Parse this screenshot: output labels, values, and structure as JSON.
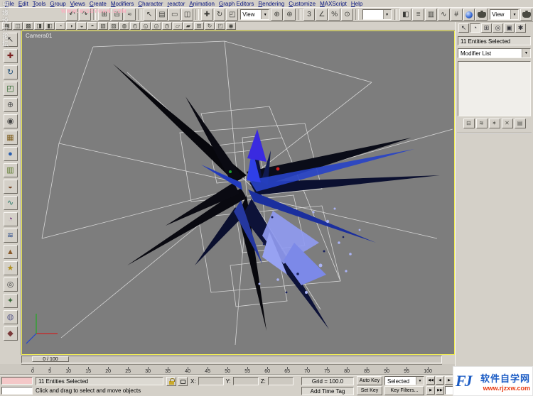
{
  "watermarks": {
    "forum_vertical": "思缘设计论坛",
    "forum_url": "WWW.MISSYUAN.COM",
    "site_logo": "FJ",
    "site_name": "软件自学网",
    "site_url": "www.rjzxw.com"
  },
  "icons": {
    "dropdown_arrow": "▼"
  },
  "menu": {
    "items": [
      "File",
      "Edit",
      "Tools",
      "Group",
      "Views",
      "Create",
      "Modifiers",
      "Character",
      "reactor",
      "Animation",
      "Graph Editors",
      "Rendering",
      "Customize",
      "MAXScript",
      "Help"
    ]
  },
  "toolbar_main": {
    "items": [
      {
        "t": "icon",
        "name": "undo",
        "g": "↶"
      },
      {
        "t": "icon",
        "name": "redo",
        "g": "↷"
      },
      {
        "t": "sep"
      },
      {
        "t": "icon",
        "name": "select-and-link",
        "g": "⊞"
      },
      {
        "t": "icon",
        "name": "unlink-selection",
        "g": "⊟"
      },
      {
        "t": "icon",
        "name": "bind-to-space-warp",
        "g": "≈"
      },
      {
        "t": "sep"
      },
      {
        "t": "icon",
        "name": "select-object",
        "g": "↖"
      },
      {
        "t": "icon",
        "name": "select-by-name",
        "g": "▤"
      },
      {
        "t": "icon",
        "name": "rectangular-selection-region",
        "g": "▭"
      },
      {
        "t": "icon",
        "name": "window-crossing-toggle",
        "g": "◫"
      },
      {
        "t": "sep"
      },
      {
        "t": "icon",
        "name": "select-and-move",
        "g": "✚"
      },
      {
        "t": "icon",
        "name": "select-and-rotate",
        "g": "↻"
      },
      {
        "t": "icon",
        "name": "select-and-scale",
        "g": "◰"
      },
      {
        "t": "dd",
        "name": "reference-coordinate-system",
        "value": "View"
      },
      {
        "t": "icon",
        "name": "use-pivot-point-center",
        "g": "⊕"
      },
      {
        "t": "icon",
        "name": "select-and-manipulate",
        "g": "⊛"
      },
      {
        "t": "sep"
      },
      {
        "t": "icon",
        "name": "snap-toggle-3d",
        "g": "3"
      },
      {
        "t": "icon",
        "name": "angle-snap-toggle",
        "g": "∠"
      },
      {
        "t": "icon",
        "name": "percent-snap-toggle",
        "g": "%"
      },
      {
        "t": "icon",
        "name": "spinner-snap-toggle",
        "g": "⊙"
      },
      {
        "t": "sep"
      },
      {
        "t": "dd",
        "name": "named-selection-sets",
        "value": ""
      },
      {
        "t": "sep"
      },
      {
        "t": "icon",
        "name": "mirror",
        "g": "◧"
      },
      {
        "t": "icon",
        "name": "align",
        "g": "≡"
      },
      {
        "t": "icon",
        "name": "layer-manager",
        "g": "▥"
      },
      {
        "t": "icon",
        "name": "curve-editor",
        "g": "∿"
      },
      {
        "t": "icon",
        "name": "schematic-view",
        "g": "#"
      },
      {
        "t": "icon",
        "name": "material-editor",
        "special": "sphere"
      },
      {
        "t": "icon",
        "name": "render-scene",
        "special": "teapot"
      },
      {
        "t": "dd",
        "name": "render-type",
        "value": "View"
      },
      {
        "t": "icon",
        "name": "quick-render",
        "special": "teapot"
      }
    ]
  },
  "toolbar_extra": {
    "items": [
      {
        "t": "icon",
        "name": "array",
        "g": "▦"
      },
      {
        "t": "icon",
        "name": "snapshot",
        "g": "◫"
      },
      {
        "t": "icon",
        "name": "spacing-tool",
        "g": "▩"
      },
      {
        "t": "icon",
        "name": "clone",
        "g": "◨"
      },
      {
        "t": "icon",
        "name": "normal-align",
        "g": "◧"
      },
      {
        "t": "icon",
        "name": "align-camera",
        "g": "◔"
      },
      {
        "t": "icon",
        "name": "place-highlight",
        "g": "◑"
      },
      {
        "t": "icon",
        "name": "quick-align",
        "g": "◒"
      },
      {
        "t": "icon",
        "name": "isolate-selection",
        "g": "◓"
      },
      {
        "t": "icon",
        "name": "display-floater",
        "g": "▧"
      },
      {
        "t": "icon",
        "name": "layer-properties",
        "g": "▨"
      },
      {
        "t": "icon",
        "name": "hide-selection",
        "g": "◍"
      },
      {
        "t": "icon",
        "name": "freeze-selection",
        "g": "◴"
      },
      {
        "t": "icon",
        "name": "unhide-all",
        "g": "◵"
      },
      {
        "t": "icon",
        "name": "unfreeze-all",
        "g": "◶"
      },
      {
        "t": "icon",
        "name": "see-through",
        "g": "◷"
      },
      {
        "t": "icon",
        "name": "wireframe-toggle",
        "g": "▱"
      },
      {
        "t": "icon",
        "name": "edged-faces",
        "g": "▰"
      },
      {
        "t": "icon",
        "name": "show-grid",
        "g": "⊞"
      },
      {
        "t": "icon",
        "name": "views-redraw",
        "g": "↻"
      },
      {
        "t": "icon",
        "name": "zoom-extents",
        "g": "◰"
      },
      {
        "t": "icon",
        "name": "units-setup",
        "g": "◉"
      }
    ]
  },
  "left_toolbar": {
    "items": [
      {
        "t": "icon",
        "name": "select-tool",
        "g": "↖",
        "c": "#333333"
      },
      {
        "t": "icon",
        "name": "move-tool",
        "g": "✚",
        "c": "#7a2020"
      },
      {
        "t": "icon",
        "name": "rotate-tool",
        "g": "↻",
        "c": "#20507a"
      },
      {
        "t": "icon",
        "name": "scale-tool",
        "g": "◰",
        "c": "#206020"
      },
      {
        "t": "icon",
        "name": "pan-tool",
        "g": "⊕",
        "c": "#555555"
      },
      {
        "t": "icon",
        "name": "zoom-tool",
        "g": "◉",
        "c": "#444444"
      },
      {
        "t": "icon",
        "name": "box-primitive",
        "g": "▦",
        "c": "#806020"
      },
      {
        "t": "icon",
        "name": "sphere-primitive",
        "g": "●",
        "c": "#2a5fae"
      },
      {
        "t": "icon",
        "name": "cylinder-primitive",
        "g": "▥",
        "c": "#5a7a2a"
      },
      {
        "t": "icon",
        "name": "teapot-primitive",
        "g": "◒",
        "c": "#7a4a2a"
      },
      {
        "t": "icon",
        "name": "spline-tool",
        "g": "∿",
        "c": "#2a7a6a"
      },
      {
        "t": "icon",
        "name": "bend-modifier",
        "g": "◔",
        "c": "#6a2a7a"
      },
      {
        "t": "icon",
        "name": "twist-modifier",
        "g": "≋",
        "c": "#2a4a8a"
      },
      {
        "t": "icon",
        "name": "taper-modifier",
        "g": "▲",
        "c": "#8a5a2a"
      },
      {
        "t": "icon",
        "name": "light-tool",
        "g": "★",
        "c": "#b09020"
      },
      {
        "t": "icon",
        "name": "camera-tool",
        "g": "◎",
        "c": "#444444"
      },
      {
        "t": "icon",
        "name": "helper-tool",
        "g": "✦",
        "c": "#3a6a3a"
      },
      {
        "t": "icon",
        "name": "space-warp-tool",
        "g": "◍",
        "c": "#5a5a8a"
      },
      {
        "t": "icon",
        "name": "system-tool",
        "g": "◆",
        "c": "#7a3a3a"
      }
    ]
  },
  "viewport": {
    "label": "Camera01"
  },
  "command_panel": {
    "tabs": [
      {
        "name": "create",
        "glyph": "↖"
      },
      {
        "name": "modify",
        "glyph": "◔",
        "active": true
      },
      {
        "name": "hierarchy",
        "glyph": "⊞"
      },
      {
        "name": "motion",
        "glyph": "◎"
      },
      {
        "name": "display",
        "glyph": "▣"
      },
      {
        "name": "utilities",
        "glyph": "✱"
      }
    ],
    "selection_field": "11 Entities Selected",
    "modifier_list": "Modifier List",
    "stack_buttons": [
      {
        "name": "pin-stack",
        "glyph": "⊟"
      },
      {
        "name": "show-end-result",
        "glyph": "≋"
      },
      {
        "name": "make-unique",
        "glyph": "✶"
      },
      {
        "name": "remove-modifier",
        "glyph": "✕"
      },
      {
        "name": "configure-modifier-sets",
        "glyph": "▤"
      }
    ]
  },
  "timeline": {
    "slider_label": "0 / 100",
    "ticks": [
      "0",
      "5",
      "10",
      "15",
      "20",
      "25",
      "30",
      "35",
      "40",
      "45",
      "50",
      "55",
      "60",
      "65",
      "70",
      "75",
      "80",
      "85",
      "90",
      "95",
      "100"
    ]
  },
  "status": {
    "selection_text": "11 Entities Selected",
    "prompt": "Click and drag to select and move objects",
    "axis_labels": [
      "X:",
      "Y:",
      "Z:"
    ],
    "grid": "Grid = 100.0",
    "add_time_tag": "Add Time Tag",
    "auto_key": "Auto Key",
    "set_key": "Set Key",
    "selected_value": "Selected",
    "key_filters": "Key Filters...",
    "playback": [
      {
        "name": "go-to-start",
        "glyph": "◀◀"
      },
      {
        "name": "previous-frame",
        "glyph": "◀"
      },
      {
        "name": "play",
        "glyph": "▶"
      },
      {
        "name": "next-frame",
        "glyph": "▶"
      },
      {
        "name": "go-to-end",
        "glyph": "▶▶"
      }
    ]
  },
  "colors": {
    "viewport_bg": "#7d7d7d",
    "active_viewport_border": "#f0ec52",
    "wireframe": "#e3e3e3",
    "spike_dark": "#07070c",
    "spike_blue": "#2742c8",
    "cluster_blue": "#8f9af0",
    "logo_blue": "#1a5bc4",
    "logo_red": "#e8380d"
  }
}
